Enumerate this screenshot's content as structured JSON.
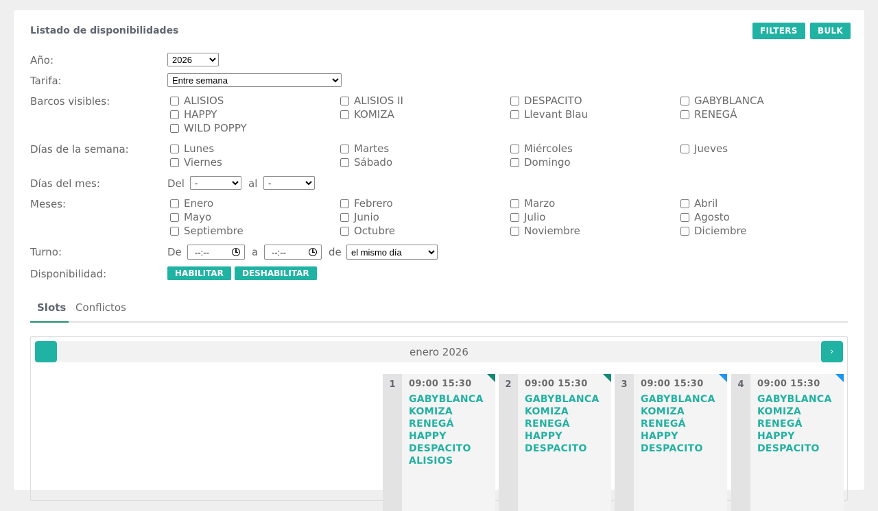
{
  "card": {
    "title": "Listado de disponibilidades"
  },
  "toolbar": {
    "filters_label": "FILTERS",
    "bulk_label": "BULK"
  },
  "form": {
    "year": {
      "label": "Año:",
      "value": "2026"
    },
    "rate": {
      "label": "Tarifa:",
      "value": "Entre semana"
    },
    "boats": {
      "label": "Barcos visibles:",
      "items": [
        "ALISIOS",
        "ALISIOS II",
        "DESPACITO",
        "GABYBLANCA",
        "HAPPY",
        "KOMIZA",
        "Llevant Blau",
        "RENEGÁ",
        "WILD POPPY"
      ]
    },
    "weekdays": {
      "label": "Días de la semana:",
      "items": [
        "Lunes",
        "Martes",
        "Miércoles",
        "Jueves",
        "Viernes",
        "Sábado",
        "Domingo"
      ]
    },
    "month_days": {
      "label": "Días del mes:",
      "from_label": "Del",
      "to_label": "al",
      "from_value": "-",
      "to_value": "-"
    },
    "months": {
      "label": "Meses:",
      "items": [
        "Enero",
        "Febrero",
        "Marzo",
        "Abril",
        "Mayo",
        "Junio",
        "Julio",
        "Agosto",
        "Septiembre",
        "Octubre",
        "Noviembre",
        "Diciembre"
      ]
    },
    "shift": {
      "label": "Turno:",
      "from_label": "De",
      "to_label": "a",
      "of_label": "de",
      "from_value": "--:--",
      "to_value": "--:--",
      "day_value": "el mismo día"
    },
    "availability": {
      "label": "Disponibilidad:",
      "enable_label": "HABILITAR",
      "disable_label": "DESHABILITAR"
    }
  },
  "tabs": [
    {
      "label": "Slots",
      "active": true
    },
    {
      "label": "Conflictos",
      "active": false
    }
  ],
  "calendar": {
    "month_label": "enero 2026",
    "next_icon": "chevron-right-icon",
    "days": [
      {
        "num": "1",
        "time": "09:00 15:30",
        "boats": [
          "GABYBLANCA",
          "KOMIZA",
          "RENEGÁ",
          "HAPPY",
          "DESPACITO",
          "ALISIOS"
        ],
        "corner": "green"
      },
      {
        "num": "2",
        "time": "09:00 15:30",
        "boats": [
          "GABYBLANCA",
          "KOMIZA",
          "RENEGÁ",
          "HAPPY",
          "DESPACITO"
        ],
        "corner": "green"
      },
      {
        "num": "3",
        "time": "09:00 15:30",
        "boats": [
          "GABYBLANCA",
          "KOMIZA",
          "RENEGÁ",
          "HAPPY",
          "DESPACITO"
        ],
        "corner": "blue"
      },
      {
        "num": "4",
        "time": "09:00 15:30",
        "boats": [
          "GABYBLANCA",
          "KOMIZA",
          "RENEGÁ",
          "HAPPY",
          "DESPACITO"
        ],
        "corner": "blue"
      }
    ]
  },
  "colors": {
    "accent": "#20b3a4",
    "boat_text": "#22b1a2",
    "corner_green": "#138a76",
    "corner_blue": "#1e96f0"
  }
}
